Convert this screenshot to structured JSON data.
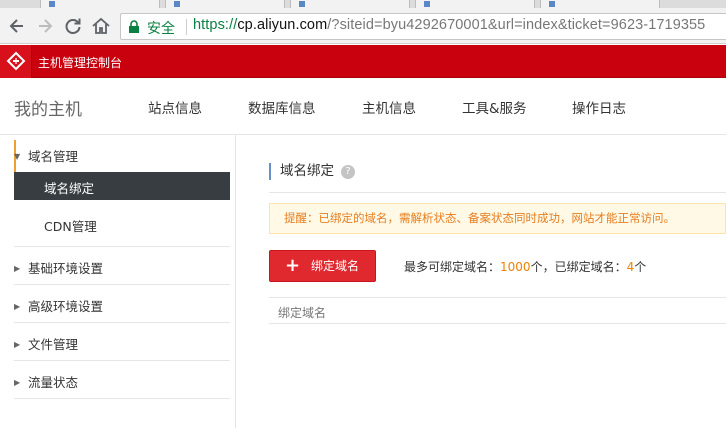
{
  "browser": {
    "secure_label": "安全",
    "url_scheme": "https://",
    "url_host": "cp.aliyun.com",
    "url_rest": "/?siteid=byu4292670001&url=index&ticket=9623-1719355"
  },
  "console": {
    "title": "主机管理控制台",
    "brand_color": "#c9000d"
  },
  "header": {
    "title": "我的主机",
    "tabs": [
      {
        "label": "站点信息"
      },
      {
        "label": "数据库信息"
      },
      {
        "label": "主机信息"
      },
      {
        "label": "工具&服务"
      },
      {
        "label": "操作日志"
      }
    ]
  },
  "sidebar": {
    "groups": [
      {
        "label": "域名管理",
        "expanded": true,
        "children": [
          {
            "label": "域名绑定",
            "active": true
          },
          {
            "label": "CDN管理",
            "active": false
          }
        ]
      },
      {
        "label": "基础环境设置",
        "expanded": false
      },
      {
        "label": "高级环境设置",
        "expanded": false
      },
      {
        "label": "文件管理",
        "expanded": false
      },
      {
        "label": "流量状态",
        "expanded": false
      }
    ]
  },
  "main": {
    "section_title": "域名绑定",
    "help_icon": "?",
    "notice": "提醒：已绑定的域名，需解析状态、备案状态同时成功，网站才能正常访问。",
    "bind_button_label": "绑定域名",
    "quota": {
      "max_prefix": "最多可绑定域名：",
      "max_value": "1000",
      "max_unit": "个，已绑定域名：",
      "bound_value": "4",
      "bound_unit": "个"
    },
    "table": {
      "columns": [
        "绑定域名"
      ]
    }
  }
}
